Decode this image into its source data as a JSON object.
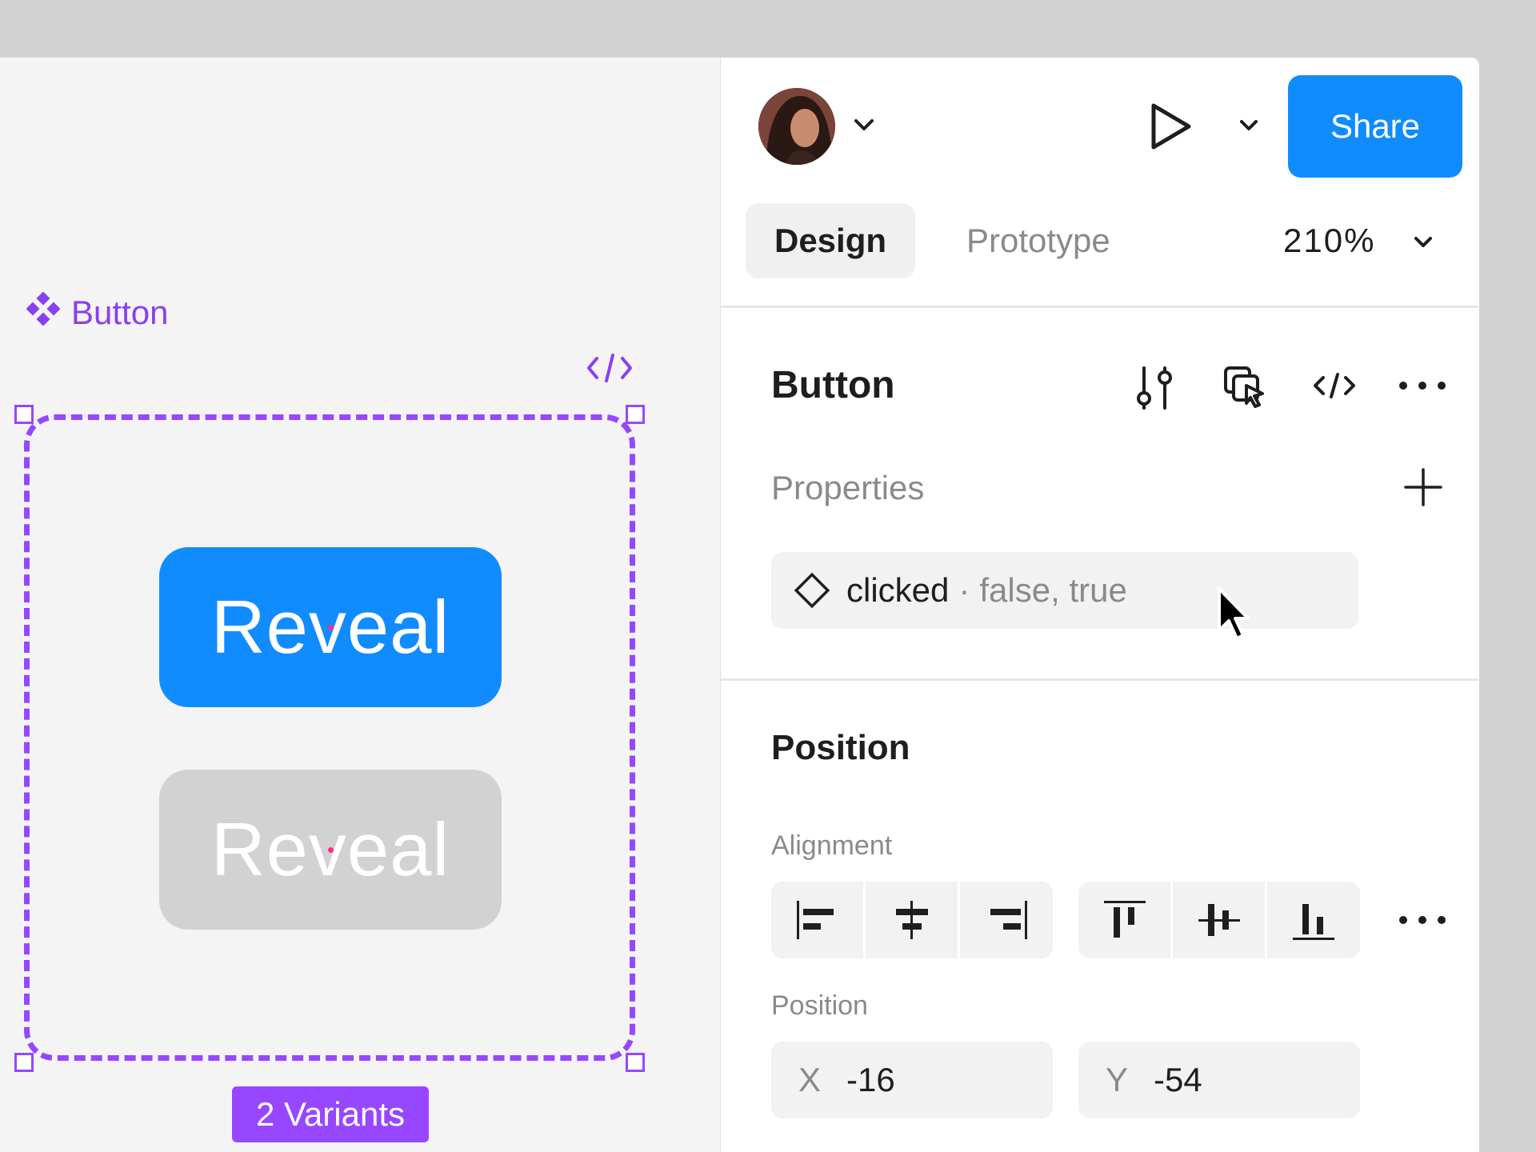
{
  "canvas": {
    "component_name": "Button",
    "variant_1_label": "Reveal",
    "variant_2_label": "Reveal",
    "variants_badge": "2 Variants",
    "accent_color": "#9747ff",
    "primary_color": "#118cff"
  },
  "header": {
    "share_label": "Share",
    "present_icon": "play-icon"
  },
  "tabs": {
    "design": "Design",
    "prototype": "Prototype",
    "zoom": "210%"
  },
  "component": {
    "title": "Button",
    "properties_label": "Properties",
    "property": {
      "name": "clicked",
      "separator": "·",
      "values": "false, true"
    }
  },
  "position_section": {
    "title": "Position",
    "alignment_label": "Alignment",
    "position_label": "Position",
    "x_axis": "X",
    "x_value": "-16",
    "y_axis": "Y",
    "y_value": "-54"
  }
}
